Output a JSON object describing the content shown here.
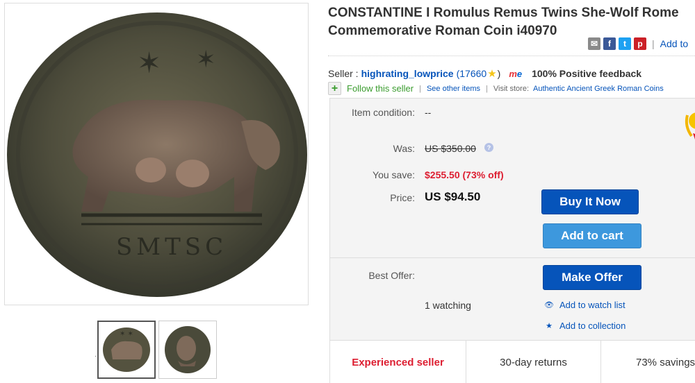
{
  "listing": {
    "title": "CONSTANTINE I Romulus Remus Twins She-Wolf Rome Commemorative Roman Coin i40970"
  },
  "share": {
    "add_to_label": "Add to",
    "separator": "|"
  },
  "seller": {
    "label": "Seller :",
    "name": "highrating_lowprice",
    "feedback_open": "(17660",
    "feedback_close": ")",
    "positive": "100% Positive feedback",
    "follow": "Follow this seller",
    "see_other": "See other items",
    "visit_store_label": "Visit store:",
    "store_name": "Authentic Ancient Greek Roman Coins",
    "pipe": "|"
  },
  "details": {
    "condition_label": "Item condition:",
    "condition_value": "--",
    "was_label": "Was:",
    "was_value": "US $350.00",
    "save_label": "You save:",
    "save_value": "$255.50 (73% off)",
    "price_label": "Price:",
    "price_value": "US $94.50",
    "best_offer_label": "Best Offer:",
    "watching": "1 watching"
  },
  "buttons": {
    "buy_now": "Buy It Now",
    "add_to_cart": "Add to cart",
    "make_offer": "Make Offer"
  },
  "links": {
    "watch_list": "Add to watch list",
    "collection": "Add to collection"
  },
  "bottom_bar": {
    "experienced": "Experienced seller",
    "returns": "30-day returns",
    "savings": "73% savings"
  },
  "coin": {
    "inscription": "SMTSC"
  },
  "colors": {
    "link_blue": "#0654ba",
    "buy_blue": "#0654ba",
    "cart_blue": "#3d98dd",
    "save_red": "#dd1e31",
    "follow_green": "#3a9c2e"
  }
}
